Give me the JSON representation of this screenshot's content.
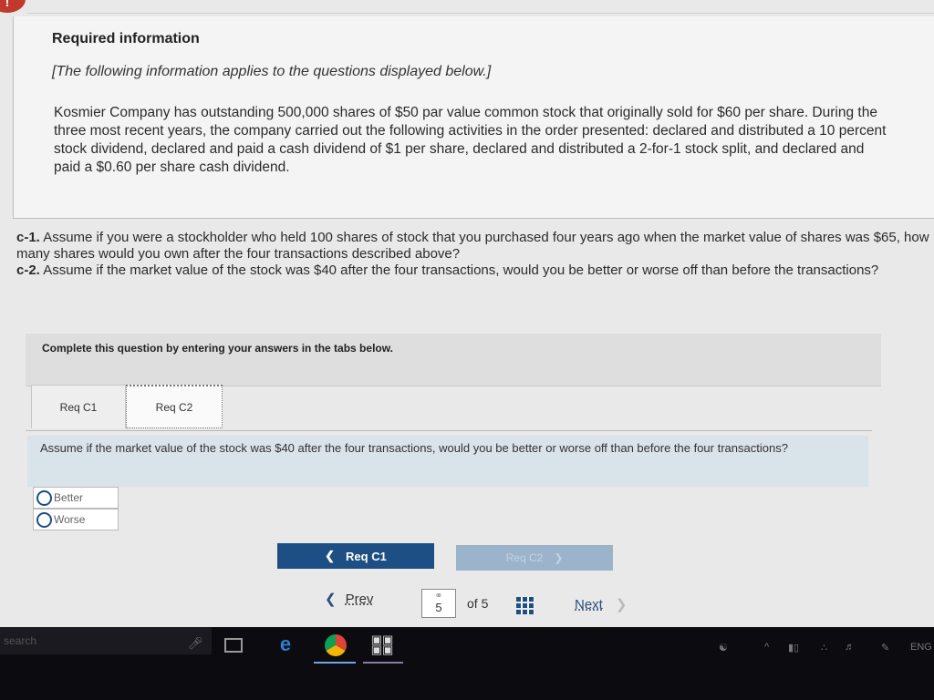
{
  "alert": {
    "symbol": "!"
  },
  "info": {
    "title": "Required information",
    "subtitle": "[The following information applies to the questions displayed below.]",
    "body": "Kosmier Company has outstanding 500,000 shares of $50 par value common stock that originally sold for $60 per share. During the three most recent years, the company carried out the following activities in the order presented: declared and distributed a 10 percent stock dividend, declared and paid a cash dividend of $1 per share, declared and distributed a 2-for-1 stock split, and declared and paid a $0.60 per share cash dividend."
  },
  "questions": {
    "c1_label": "c-1.",
    "c1_text": " Assume if you were a stockholder who held 100 shares of stock that you purchased four years ago when the market value of shares was $65, how many shares would you own after the four transactions described above?",
    "c2_label": "c-2.",
    "c2_text": " Assume if the market value of the stock was $40 after the four transactions, would you be better or worse off than before the transactions?"
  },
  "instructions": "Complete this question by entering your answers in the tabs below.",
  "tabs": [
    {
      "label": "Req C1",
      "active": false
    },
    {
      "label": "Req C2",
      "active": true
    }
  ],
  "prompt": "Assume if the market value of the stock was $40 after the four transactions, would you be better or worse off than before the four transactions?",
  "options": [
    {
      "label": "Better",
      "selected": false
    },
    {
      "label": "Worse",
      "selected": false
    }
  ],
  "nav_buttons": {
    "prev_label": "Req C1",
    "prev_icon": "chevron-left-icon",
    "next_label": "Req C2",
    "next_icon": "chevron-right-icon",
    "next_enabled": false
  },
  "pager": {
    "prev_label": "Prev",
    "current_page": "5",
    "of_text": "of 5",
    "next_label": "Next"
  },
  "taskbar": {
    "search_placeholder": "search",
    "language": "ENG"
  },
  "colors": {
    "primary_button": "#1d4e84",
    "disabled_button": "#9bb3cb",
    "prompt_background": "#d9e3ea",
    "alert": "#c0392b"
  }
}
